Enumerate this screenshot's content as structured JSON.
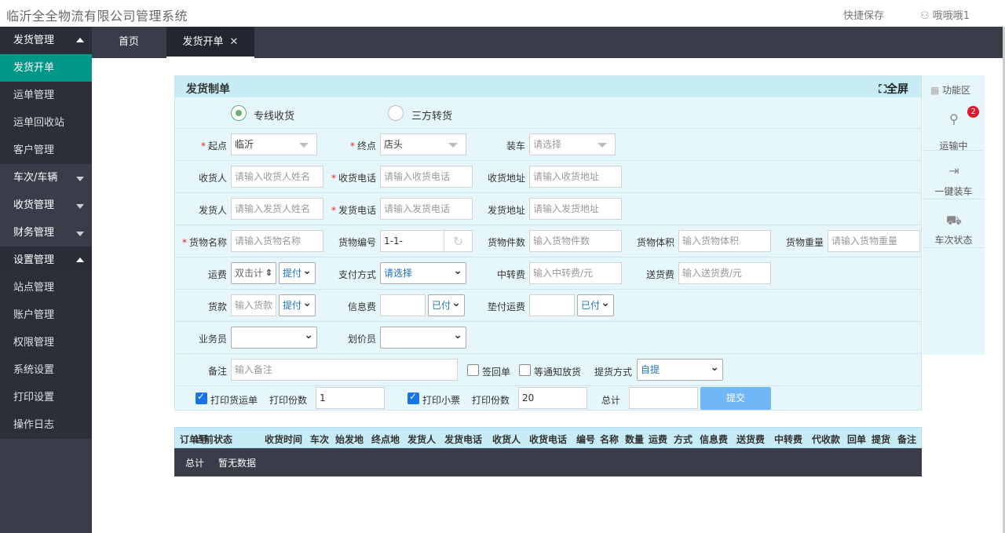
{
  "app": {
    "title": "临沂全全物流有限公司管理系统",
    "quick_save": "快捷保存",
    "user": "哦哦哦1"
  },
  "tabs": [
    {
      "label": "首页"
    },
    {
      "label": "发货开单",
      "close": "✕"
    }
  ],
  "sidebar": {
    "items": [
      {
        "label": "发货管理",
        "kind": "group",
        "expanded": true
      },
      {
        "label": "发货开单",
        "kind": "active"
      },
      {
        "label": "运单管理",
        "kind": "sub"
      },
      {
        "label": "运单回收站",
        "kind": "sub"
      },
      {
        "label": "客户管理",
        "kind": "sub"
      },
      {
        "label": "车次/车辆",
        "kind": "group-closed",
        "expanded": false
      },
      {
        "label": "收货管理",
        "kind": "group-closed",
        "expanded": false
      },
      {
        "label": "财务管理",
        "kind": "group-closed",
        "expanded": false
      },
      {
        "label": "设置管理",
        "kind": "group",
        "expanded": true
      },
      {
        "label": "站点管理",
        "kind": "sub"
      },
      {
        "label": "账户管理",
        "kind": "sub"
      },
      {
        "label": "权限管理",
        "kind": "sub"
      },
      {
        "label": "系统设置",
        "kind": "sub"
      },
      {
        "label": "打印设置",
        "kind": "sub"
      },
      {
        "label": "操作日志",
        "kind": "sub"
      }
    ]
  },
  "form": {
    "title": "发货制单",
    "fullscreen": "全屏",
    "radio_dedicated": "专线收货",
    "radio_third": "三方转货",
    "origin_label": "起点",
    "origin_value": "临沂",
    "dest_label": "终点",
    "dest_value": "店头",
    "loading_label": "装车",
    "loading_placeholder": "请选择",
    "receiver_label": "收货人",
    "receiver_placeholder": "请输入收货人姓名",
    "receiver_phone_label": "收货电话",
    "receiver_phone_placeholder": "请输入收货电话",
    "receiver_addr_label": "收货地址",
    "receiver_addr_placeholder": "请输入收货地址",
    "sender_label": "发货人",
    "sender_placeholder": "请输入发货人姓名",
    "sender_phone_label": "发货电话",
    "sender_phone_placeholder": "请输入发货电话",
    "sender_addr_label": "发货地址",
    "sender_addr_placeholder": "请输入发货地址",
    "goods_name_label": "货物名称",
    "goods_name_placeholder": "请输入货物名称",
    "goods_no_label": "货物编号",
    "goods_no_value": "1-1-",
    "goods_count_label": "货物件数",
    "goods_count_placeholder": "输入货物件数",
    "goods_volume_label": "货物体积",
    "goods_volume_placeholder": "输入货物体积",
    "goods_weight_label": "货物重量",
    "goods_weight_placeholder": "请输入货物重量",
    "freight_label": "运费",
    "freight_calc": "双击计",
    "freight_mode": "提付",
    "pay_label": "支付方式",
    "pay_value": "请选择",
    "transfer_label": "中转费",
    "transfer_placeholder": "输入中转费/元",
    "delivery_label": "送货费",
    "delivery_placeholder": "输入送货费/元",
    "goods_pay_label": "货款",
    "goods_pay_placeholder": "输入货款",
    "goods_pay_mode": "提付",
    "info_fee_label": "信息费",
    "info_fee_mode": "已付",
    "advance_label": "垫付运费",
    "advance_mode": "已付",
    "salesman_label": "业务员",
    "pricer_label": "划价员",
    "remark_label": "备注",
    "remark_placeholder": "输入备注",
    "sign_back": "签回单",
    "wait_notice": "等通知放货",
    "pickup_label": "提货方式",
    "pickup_value": "自提",
    "print_waybill": "打印货运单",
    "print_copies_label": "打印份数",
    "print_copies_value": "1",
    "print_ticket": "打印小票",
    "print_copies2_label": "打印份数",
    "print_copies2_value": "20",
    "total_label": "总计",
    "submit": "提交"
  },
  "fnpanel": {
    "title": "功能区",
    "in_transit": "运输中",
    "badge": "2",
    "one_click_load": "一键装车",
    "trip_status": "车次状态"
  },
  "table": {
    "headers": [
      "订单号",
      "当前状态",
      "收货时间",
      "车次",
      "始发地",
      "终点地",
      "发货人",
      "发货电话",
      "收货人",
      "收货电话",
      "编号",
      "名称",
      "数量",
      "运费",
      "方式",
      "信息费",
      "送货费",
      "中转费",
      "代收款",
      "回单",
      "提货",
      "备注"
    ],
    "total_label": "总计",
    "empty": "暂无数据"
  }
}
